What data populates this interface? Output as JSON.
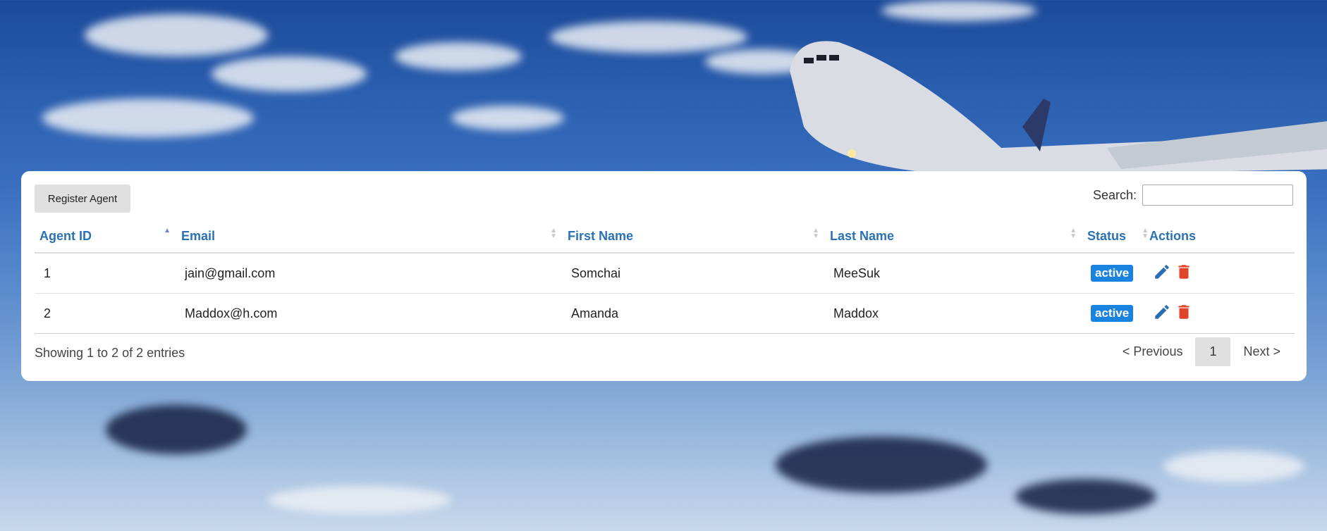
{
  "toolbar": {
    "register_label": "Register Agent"
  },
  "search": {
    "label": "Search:",
    "placeholder": ""
  },
  "table": {
    "headers": [
      "Agent ID",
      "Email",
      "First Name",
      "Last Name",
      "Status",
      "Actions"
    ],
    "rows": [
      {
        "id": "1",
        "email": "jain@gmail.com",
        "first_name": "Somchai",
        "last_name": "MeeSuk",
        "status": "active"
      },
      {
        "id": "2",
        "email": "Maddox@h.com",
        "first_name": "Amanda",
        "last_name": "Maddox",
        "status": "active"
      }
    ]
  },
  "footer": {
    "info": "Showing 1 to 2 of 2 entries",
    "previous": "< Previous",
    "current_page": "1",
    "next": "Next >"
  },
  "colors": {
    "link": "#2a72b5",
    "badge": "#1a83e0",
    "edit_icon": "#2a6db5",
    "delete_icon": "#e0442a"
  },
  "icons": {
    "edit": "pencil-icon",
    "delete": "trash-icon"
  }
}
